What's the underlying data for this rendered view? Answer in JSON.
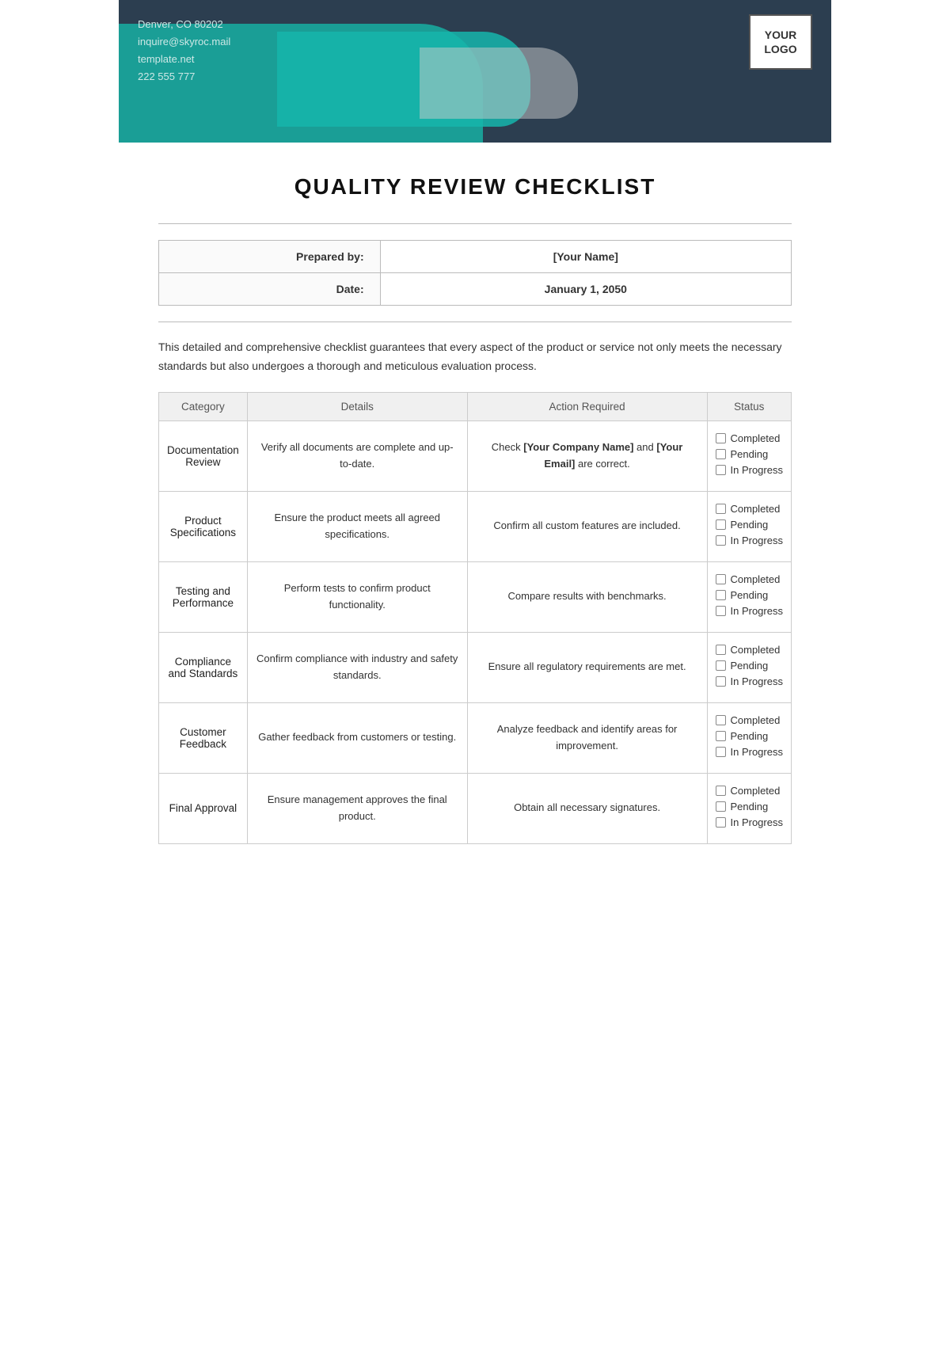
{
  "header": {
    "contact": {
      "address": "Denver, CO 80202",
      "email": "inquire@skyroc.mail",
      "website": "template.net",
      "phone": "222 555 777"
    },
    "logo": "YOUR\nLOGO"
  },
  "title": "QUALITY REVIEW CHECKLIST",
  "info": {
    "prepared_by_label": "Prepared by:",
    "prepared_by_value": "[Your Name]",
    "date_label": "Date:",
    "date_value": "January 1, 2050"
  },
  "description": "This detailed and comprehensive checklist guarantees that every aspect of the product or service not only meets the necessary standards but also undergoes a thorough and meticulous evaluation process.",
  "table": {
    "headers": [
      "Category",
      "Details",
      "Action Required",
      "Status"
    ],
    "rows": [
      {
        "category": "Documentation\nReview",
        "details": "Verify all documents are complete and up-to-date.",
        "action": "Check [Your Company Name] and [Your Email] are correct.",
        "action_bold": [
          "[Your Company Name]",
          "[Your Email]"
        ],
        "status": [
          "Completed",
          "Pending",
          "In Progress"
        ]
      },
      {
        "category": "Product\nSpecifications",
        "details": "Ensure the product meets all agreed specifications.",
        "action": "Confirm all custom features are included.",
        "action_bold": [],
        "status": [
          "Completed",
          "Pending",
          "In Progress"
        ]
      },
      {
        "category": "Testing and\nPerformance",
        "details": "Perform tests to confirm product functionality.",
        "action": "Compare results with benchmarks.",
        "action_bold": [],
        "status": [
          "Completed",
          "Pending",
          "In Progress"
        ]
      },
      {
        "category": "Compliance\nand Standards",
        "details": "Confirm compliance with industry and safety standards.",
        "action": "Ensure all regulatory requirements are met.",
        "action_bold": [],
        "status": [
          "Completed",
          "Pending",
          "In Progress"
        ]
      },
      {
        "category": "Customer\nFeedback",
        "details": "Gather feedback from customers or testing.",
        "action": "Analyze feedback and identify areas for improvement.",
        "action_bold": [],
        "status": [
          "Completed",
          "Pending",
          "In Progress"
        ]
      },
      {
        "category": "Final Approval",
        "details": "Ensure management approves the final product.",
        "action": "Obtain all necessary signatures.",
        "action_bold": [],
        "status": [
          "Completed",
          "Pending",
          "In Progress"
        ]
      }
    ]
  }
}
